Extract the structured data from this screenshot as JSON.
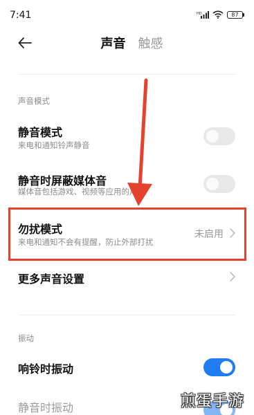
{
  "status_bar": {
    "time": "7:41",
    "signal_label": "HD",
    "battery": "87"
  },
  "header": {
    "tabs": [
      {
        "label": "声音",
        "active": true
      },
      {
        "label": "触感",
        "active": false
      }
    ]
  },
  "sections": {
    "sound_mode": {
      "label": "声音模式",
      "silent_mode": {
        "title": "静音模式",
        "subtitle": "来电和通知铃声静音",
        "enabled": false
      },
      "mute_media": {
        "title": "静音时屏蔽媒体音",
        "subtitle": "媒体音包括游戏、视频等应用的声音",
        "enabled": false
      },
      "dnd": {
        "title": "勿扰模式",
        "subtitle": "来电和通知不会有提醒，防止外部打扰",
        "value": "未启用"
      },
      "more_sound": {
        "title": "更多声音设置"
      }
    },
    "vibration": {
      "label": "振动",
      "vibrate_on_ring": {
        "title": "响铃时振动",
        "enabled": true
      },
      "vibrate_on_silent": {
        "title": "静音时振动",
        "enabled": true
      }
    }
  },
  "watermark": "煎蛋手游",
  "colors": {
    "accent": "#1f7cf2",
    "highlight_border": "#e5422d",
    "arrow": "#e5422d"
  }
}
